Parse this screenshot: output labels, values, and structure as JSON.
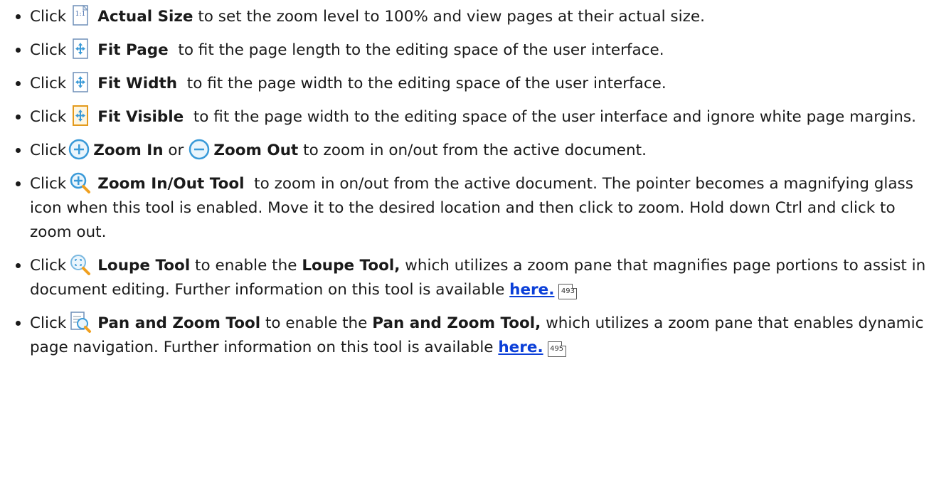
{
  "items": [
    {
      "click": "Click",
      "tool": "Actual Size",
      "rest": "to set the zoom level to 100% and view pages at their actual size.",
      "icon": "actual-size-icon"
    },
    {
      "click": "Click",
      "tool": "Fit Page",
      "rest": "to fit the page length to the editing space of the user interface.",
      "icon": "fit-page-icon"
    },
    {
      "click": "Click",
      "tool": "Fit Width",
      "rest": "to fit the page width to the editing space of the user interface.",
      "icon": "fit-width-icon"
    },
    {
      "click": "Click",
      "tool": "Fit Visible",
      "rest": "to fit the page width to the editing space of the user interface and ignore white page margins.",
      "icon": "fit-visible-icon"
    },
    {
      "click": "Click",
      "tool": "Zoom In",
      "mid": "or",
      "tool2": "Zoom Out",
      "rest": "to zoom in on/out from the active document.",
      "icon": "zoom-in-icon",
      "icon2": "zoom-out-icon"
    },
    {
      "click": "Click",
      "tool": "Zoom In/Out Tool",
      "rest": "to zoom in on/out from the active document. The pointer becomes a magnifying glass icon when this tool is enabled. Move it to the desired location and then click to zoom. Hold down Ctrl and click to zoom out.",
      "icon": "zoom-tool-icon"
    },
    {
      "click": "Click",
      "tool": "Loupe Tool",
      "rest_a": "to enable the",
      "tool_inline": "Loupe Tool,",
      "rest_b": "which utilizes a zoom pane that magnifies page portions to assist in document editing. Further information on this tool is available",
      "link": "here.",
      "page_ref": "493",
      "icon": "loupe-tool-icon"
    },
    {
      "click": "Click",
      "tool": "Pan and Zoom Tool",
      "rest_a": "to enable the",
      "tool_inline": "Pan and Zoom Tool,",
      "rest_b": "which utilizes a zoom pane that enables dynamic page navigation. Further information on this tool is available",
      "link": "here.",
      "page_ref": "495",
      "icon": "pan-zoom-tool-icon"
    }
  ]
}
